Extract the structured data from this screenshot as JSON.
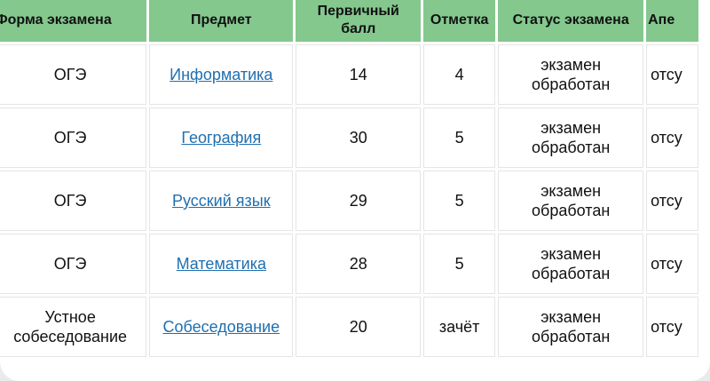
{
  "table": {
    "headers": [
      "Форма экзамена",
      "Предмет",
      "Первичный\nбалл",
      "Отметка",
      "Статус экзамена",
      "Апе"
    ],
    "rows": [
      {
        "form": "ОГЭ",
        "subject": "Информатика",
        "score": "14",
        "grade": "4",
        "status": "экзамен\nобработан",
        "appeal": "отсу"
      },
      {
        "form": "ОГЭ",
        "subject": "География",
        "score": "30",
        "grade": "5",
        "status": "экзамен\nобработан",
        "appeal": "отсу"
      },
      {
        "form": "ОГЭ",
        "subject": "Русский язык",
        "score": "29",
        "grade": "5",
        "status": "экзамен\nобработан",
        "appeal": "отсу"
      },
      {
        "form": "ОГЭ",
        "subject": "Математика",
        "score": "28",
        "grade": "5",
        "status": "экзамен\nобработан",
        "appeal": "отсу"
      },
      {
        "form": "Устное\nсобеседование",
        "subject": "Собеседование",
        "score": "20",
        "grade": "зачёт",
        "status": "экзамен\nобработан",
        "appeal": "отсу"
      }
    ]
  },
  "colors": {
    "header_bg": "#84c88e",
    "link": "#1f6fb0"
  }
}
